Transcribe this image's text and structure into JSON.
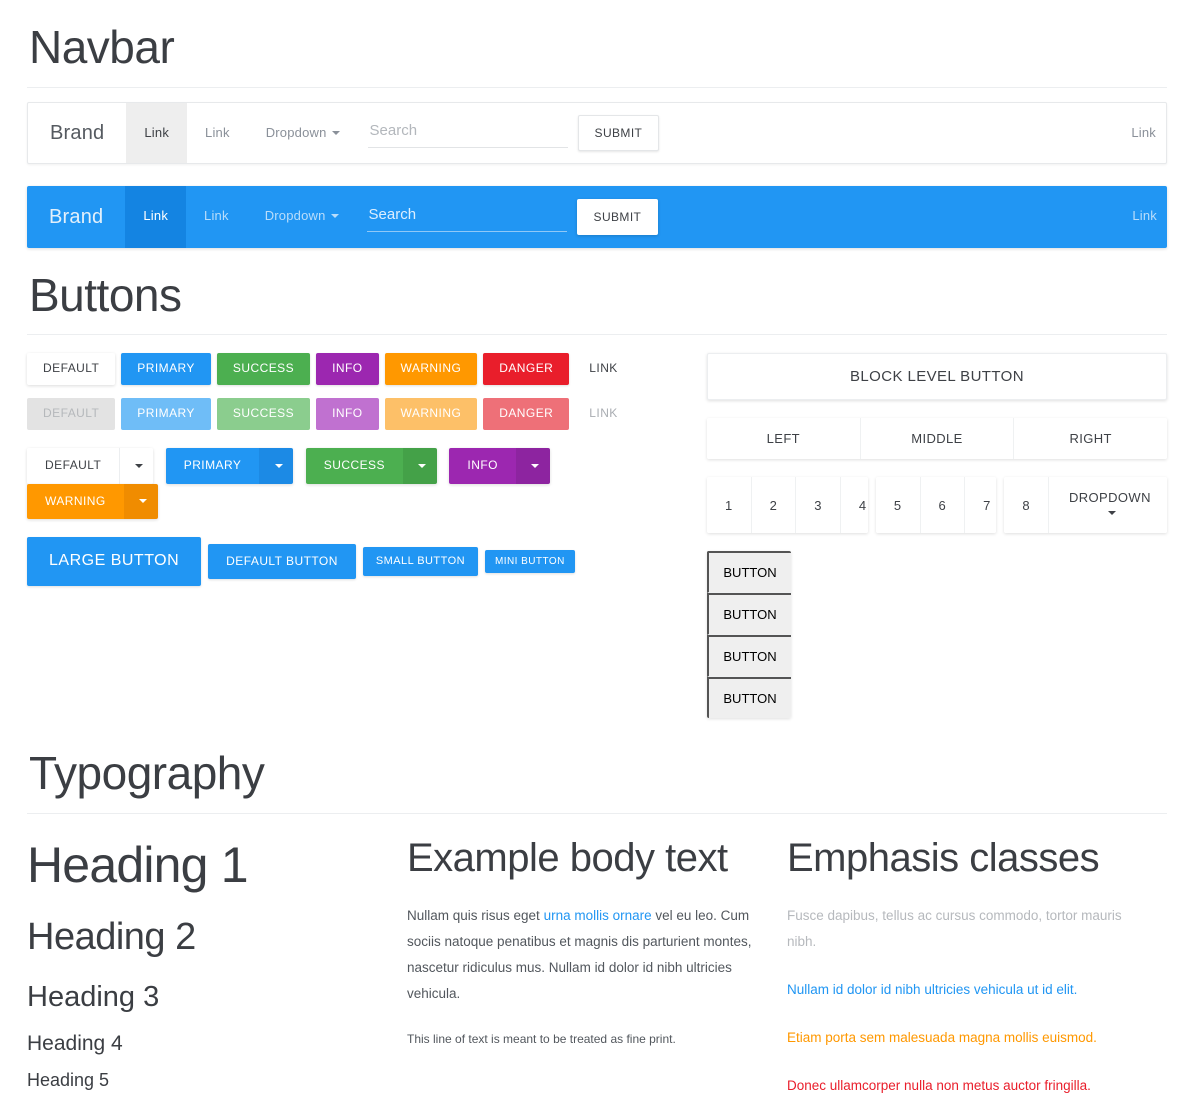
{
  "sections": {
    "navbar_title": "Navbar",
    "buttons_title": "Buttons",
    "typography_title": "Typography"
  },
  "navbar_default": {
    "brand": "Brand",
    "link_active": "Link",
    "link": "Link",
    "dropdown": "Dropdown",
    "search_placeholder": "Search",
    "submit": "SUBMIT",
    "right_link": "Link"
  },
  "navbar_inverse": {
    "brand": "Brand",
    "link_active": "Link",
    "link": "Link",
    "dropdown": "Dropdown",
    "search_placeholder": "Search",
    "submit": "SUBMIT",
    "right_link": "Link",
    "background_color": "#2196f3"
  },
  "buttons": {
    "contextual": [
      {
        "label": "DEFAULT",
        "variant": "default",
        "color": "#ffffff"
      },
      {
        "label": "PRIMARY",
        "variant": "primary",
        "color": "#2196f3"
      },
      {
        "label": "SUCCESS",
        "variant": "success",
        "color": "#4caf50"
      },
      {
        "label": "INFO",
        "variant": "info",
        "color": "#9c27b0"
      },
      {
        "label": "WARNING",
        "variant": "warning",
        "color": "#ff9800"
      },
      {
        "label": "DANGER",
        "variant": "danger",
        "color": "#e91e2b"
      },
      {
        "label": "LINK",
        "variant": "link",
        "color": "#3e4146"
      }
    ],
    "disabled": [
      {
        "label": "DEFAULT",
        "variant": "default"
      },
      {
        "label": "PRIMARY",
        "variant": "primary"
      },
      {
        "label": "SUCCESS",
        "variant": "success"
      },
      {
        "label": "INFO",
        "variant": "info"
      },
      {
        "label": "WARNING",
        "variant": "warning"
      },
      {
        "label": "DANGER",
        "variant": "danger"
      },
      {
        "label": "LINK",
        "variant": "link"
      }
    ],
    "split_dropdowns": [
      {
        "label": "DEFAULT",
        "variant": "default"
      },
      {
        "label": "PRIMARY",
        "variant": "primary"
      },
      {
        "label": "SUCCESS",
        "variant": "success"
      },
      {
        "label": "INFO",
        "variant": "info"
      },
      {
        "label": "WARNING",
        "variant": "warning"
      }
    ],
    "sizes": [
      {
        "label": "LARGE BUTTON",
        "size": "lg"
      },
      {
        "label": "DEFAULT BUTTON",
        "size": "md"
      },
      {
        "label": "SMALL BUTTON",
        "size": "sm"
      },
      {
        "label": "MINI BUTTON",
        "size": "xs"
      }
    ],
    "block_level": "BLOCK LEVEL BUTTON",
    "thirds": [
      "LEFT",
      "MIDDLE",
      "RIGHT"
    ],
    "pager_group_1": [
      "1",
      "2",
      "3",
      "4"
    ],
    "pager_group_2": [
      "5",
      "6",
      "7"
    ],
    "pager_group_3": [
      "8"
    ],
    "pager_dropdown": "DROPDOWN",
    "vertical_group": [
      "BUTTON",
      "BUTTON",
      "BUTTON",
      "BUTTON"
    ]
  },
  "typography": {
    "headings": {
      "h1": "Heading 1",
      "h2": "Heading 2",
      "h3": "Heading 3",
      "h4": "Heading 4",
      "h5": "Heading 5"
    },
    "body": {
      "title": "Example body text",
      "para_before_link": "Nullam quis risus eget ",
      "link_text": "urna mollis ornare",
      "para_after_link": " vel eu leo. Cum sociis natoque penatibus et magnis dis parturient montes, nascetur ridiculus mus. Nullam id dolor id nibh ultricies vehicula.",
      "fine_print": "This line of text is meant to be treated as fine print."
    },
    "emphasis": {
      "title": "Emphasis classes",
      "muted": "Fusce dapibus, tellus ac cursus commodo, tortor mauris nibh.",
      "primary": "Nullam id dolor id nibh ultricies vehicula ut id elit.",
      "warning": "Etiam porta sem malesuada magna mollis euismod.",
      "danger": "Donec ullamcorper nulla non metus auctor fringilla."
    }
  }
}
